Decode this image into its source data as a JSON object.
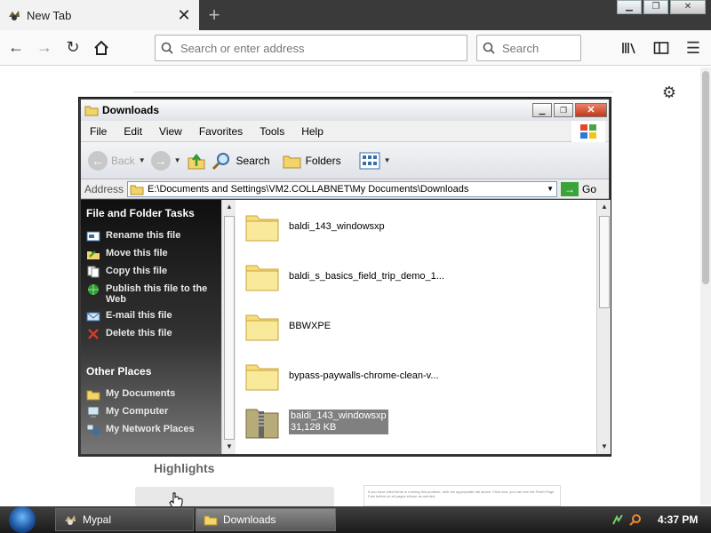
{
  "browser": {
    "tab_title": "New Tab",
    "url_placeholder": "Search or enter address",
    "search_placeholder": "Search",
    "highlights_label": "Highlights",
    "card_snippet": "If you have cited items in running this problem, click the appropriate tab above. Click now, you can see the Fetch Page Fast button on all pages shown as needed."
  },
  "explorer": {
    "title": "Downloads",
    "menu": [
      "File",
      "Edit",
      "View",
      "Favorites",
      "Tools",
      "Help"
    ],
    "toolbar": {
      "back": "Back",
      "search": "Search",
      "folders": "Folders"
    },
    "address": {
      "label": "Address",
      "path": "E:\\Documents and Settings\\VM2.COLLABNET\\My Documents\\Downloads",
      "go": "Go"
    },
    "tasks": {
      "section": "File and Folder Tasks",
      "items": [
        "Rename this file",
        "Move this file",
        "Copy this file",
        "Publish this file to the Web",
        "E-mail this file",
        "Delete this file"
      ]
    },
    "other_places": {
      "section": "Other Places",
      "items": [
        "My Documents",
        "My Computer",
        "My Network Places"
      ]
    },
    "files": [
      {
        "name": "baldi_143_windowsxp"
      },
      {
        "name": "baldi_s_basics_field_trip_demo_1..."
      },
      {
        "name": "BBWXPE"
      },
      {
        "name": "bypass-paywalls-chrome-clean-v..."
      },
      {
        "name": "baldi_143_windowsxp",
        "size": "31,128 KB",
        "selected": true
      }
    ]
  },
  "taskbar": {
    "items": [
      "Mypal",
      "Downloads"
    ],
    "clock": "4:37 PM"
  },
  "colors": {
    "task_pane_top": "#0f0f0f",
    "selection": "#808080",
    "go_green": "#3aa33a"
  }
}
